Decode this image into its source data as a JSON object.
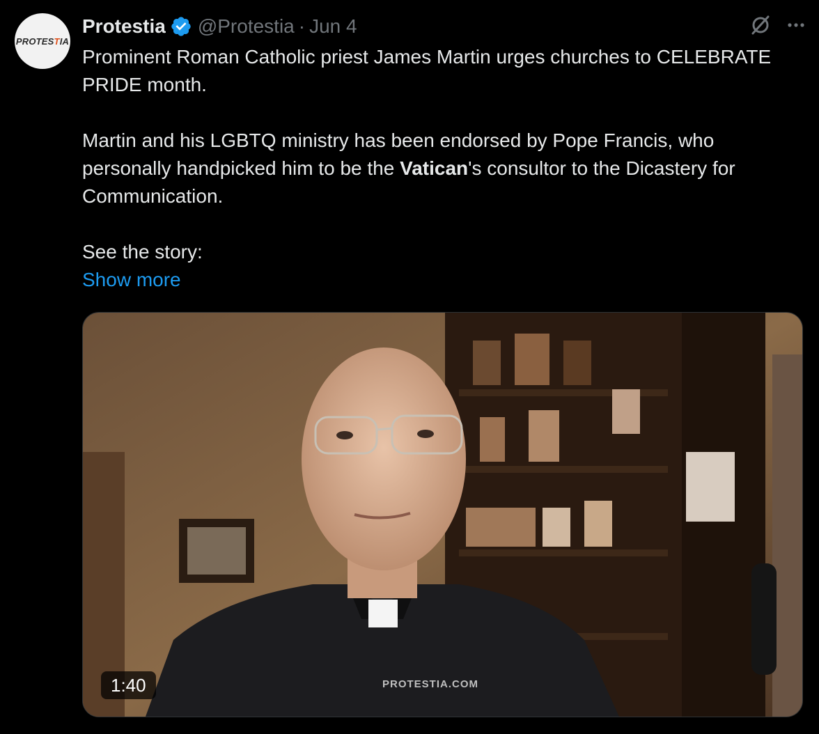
{
  "tweet": {
    "avatar_text_a": "PROTES",
    "avatar_text_b": "T",
    "avatar_text_c": "IA",
    "name": "Protestia",
    "handle": "@Protestia",
    "separator": "·",
    "date": "Jun 4",
    "text_p1": "Prominent Roman Catholic priest James Martin urges churches to CELEBRATE PRIDE month.",
    "text_p2_before": "Martin and his LGBTQ ministry has been endorsed by Pope Francis, who personally handpicked him to be the ",
    "text_p2_bold": "Vatican",
    "text_p2_after": "'s consultor to the Dicastery for Communication.",
    "text_p3": "See the story:",
    "show_more": "Show more",
    "video": {
      "duration": "1:40",
      "watermark": "PROTESTIA.COM"
    }
  },
  "icons": {
    "verified": "verified-badge-icon",
    "grok": "grok-icon",
    "more": "more-icon"
  },
  "colors": {
    "background": "#000000",
    "text": "#e7e9ea",
    "secondary": "#71767b",
    "link": "#1d9bf0",
    "verified": "#1d9bf0"
  }
}
